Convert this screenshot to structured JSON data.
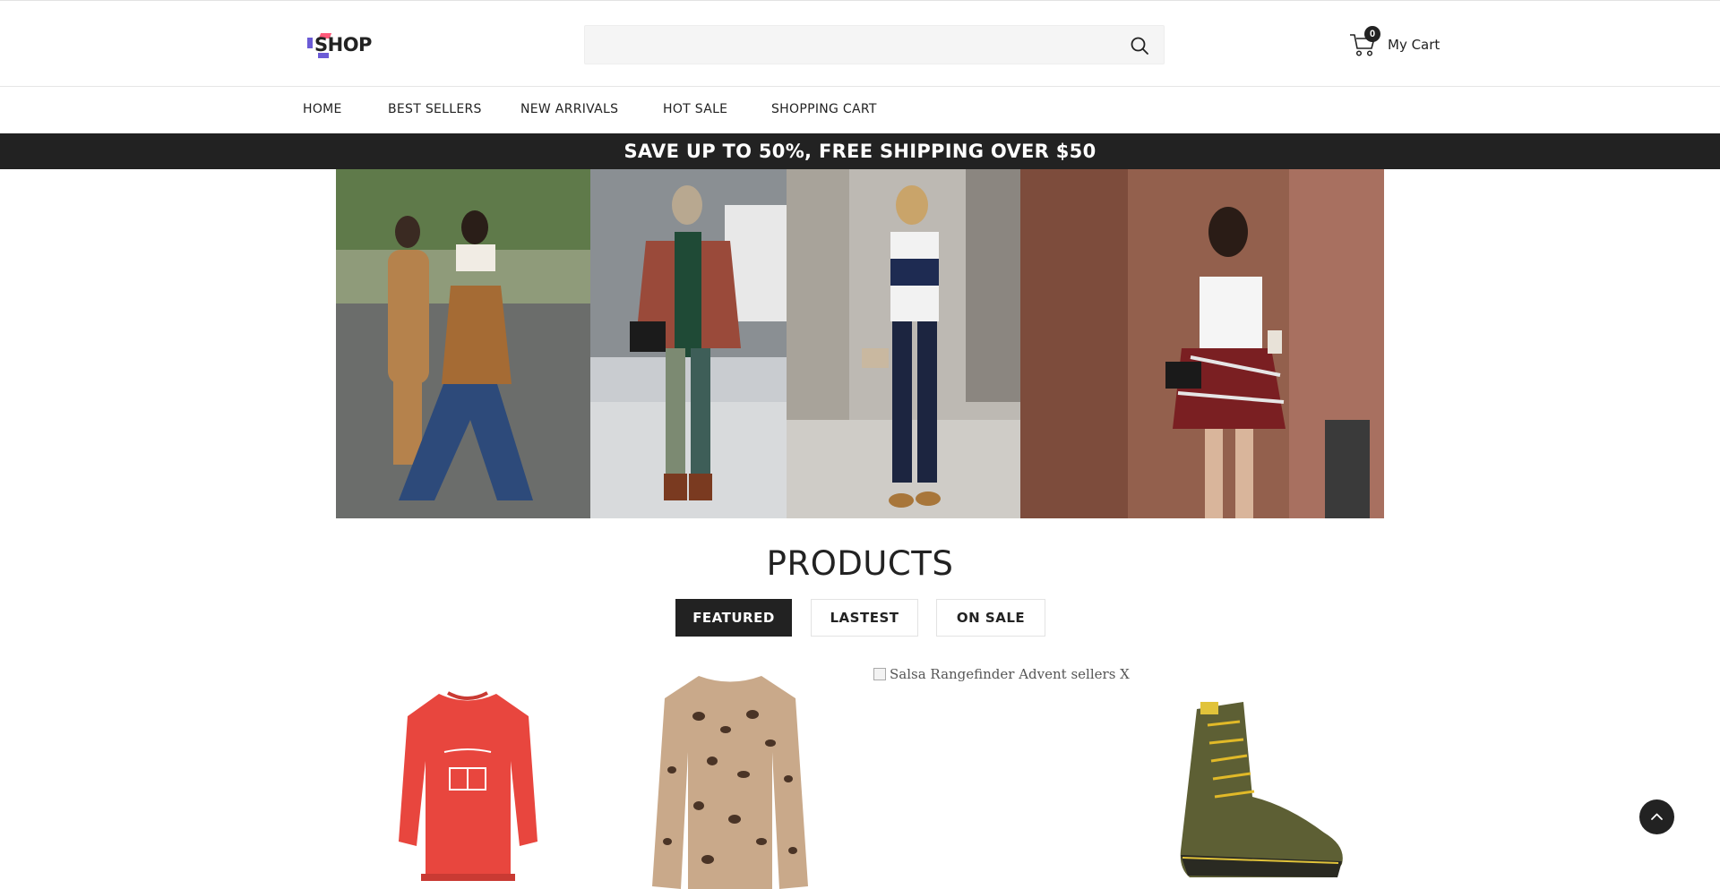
{
  "header": {
    "logo_text": "SHOP",
    "search": {
      "placeholder": "",
      "value": ""
    },
    "cart": {
      "count": "0",
      "label": "My Cart"
    }
  },
  "nav": {
    "items": [
      {
        "label": "HOME"
      },
      {
        "label": "BEST SELLERS"
      },
      {
        "label": "NEW ARRIVALS"
      },
      {
        "label": "HOT SALE"
      },
      {
        "label": "SHOPPING CART"
      }
    ]
  },
  "promo": {
    "text": "SAVE UP TO 50%, FREE SHIPPING OVER $50"
  },
  "products": {
    "title": "PRODUCTS",
    "tabs": [
      {
        "label": "FEATURED",
        "active": true
      },
      {
        "label": "LASTEST",
        "active": false
      },
      {
        "label": "ON SALE",
        "active": false
      }
    ],
    "broken_image_alt": "Salsa Rangefinder Advent sellers X"
  },
  "colors": {
    "dark": "#222222",
    "logo_purple": "#6b5bd6",
    "logo_pink": "#ff5a7a"
  },
  "icons": [
    "search-icon",
    "cart-icon",
    "chevron-up-icon"
  ]
}
